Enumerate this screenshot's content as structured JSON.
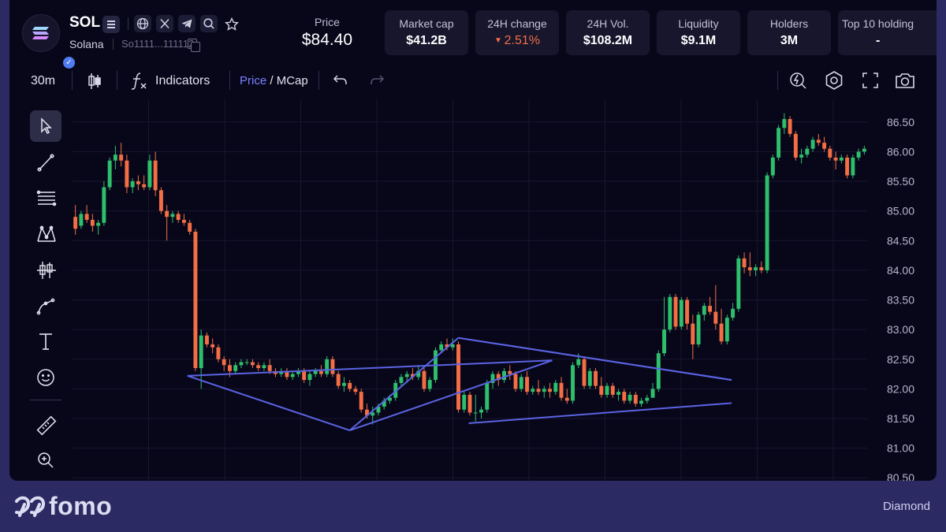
{
  "token": {
    "symbol": "SOL",
    "name": "Solana",
    "address": "So1111...111112"
  },
  "header_icons": [
    "menu-icon",
    "globe-icon",
    "x-icon",
    "telegram-icon",
    "search-icon",
    "star-icon"
  ],
  "price": {
    "label": "Price",
    "value": "$84.40"
  },
  "stats": [
    {
      "label": "Market cap",
      "value": "$41.2B"
    },
    {
      "label": "24H change",
      "value": "2.51%",
      "direction": "down"
    },
    {
      "label": "24H Vol.",
      "value": "$108.2M"
    },
    {
      "label": "Liquidity",
      "value": "$9.1M"
    },
    {
      "label": "Holders",
      "value": "3M"
    },
    {
      "label": "Top 10 holding",
      "value": "-"
    }
  ],
  "toolbar": {
    "interval": "30m",
    "indicators_label": "Indicators",
    "price_label": "Price",
    "mcap_sep": " / ",
    "mcap_label": "MCap"
  },
  "left_tools": [
    "cursor-icon",
    "trendline-icon",
    "fib-icon",
    "pattern-icon",
    "candles-icon",
    "path-icon",
    "text-icon",
    "emoji-icon",
    "ruler-icon",
    "zoom-in-icon"
  ],
  "right_tools": [
    "replay-icon",
    "settings-icon",
    "fullscreen-icon",
    "camera-icon"
  ],
  "colors": {
    "up": "#2dbf6c",
    "down": "#f36e45",
    "pattern": "#5b63e3",
    "accent": "#7c82ff"
  },
  "footer": {
    "brand": "fomo",
    "tier": "Diamond"
  },
  "chart_data": {
    "type": "candlestick",
    "y_ticks": [
      "86.50",
      "86.00",
      "85.50",
      "85.00",
      "84.50",
      "84.00",
      "83.50",
      "83.00",
      "82.50",
      "82.00",
      "81.50",
      "81.00",
      "80.50"
    ],
    "ylim": [
      80.45,
      86.75
    ],
    "grid": true,
    "ohlc": [
      [
        84.9,
        85.1,
        84.6,
        84.7
      ],
      [
        84.75,
        85.0,
        84.7,
        84.95
      ],
      [
        84.95,
        85.1,
        84.8,
        84.85
      ],
      [
        84.85,
        84.95,
        84.65,
        84.75
      ],
      [
        84.75,
        84.85,
        84.6,
        84.8
      ],
      [
        84.8,
        85.5,
        84.75,
        85.4
      ],
      [
        85.4,
        85.9,
        85.35,
        85.85
      ],
      [
        85.85,
        86.1,
        85.7,
        85.95
      ],
      [
        85.95,
        86.15,
        85.75,
        85.85
      ],
      [
        85.85,
        85.95,
        85.3,
        85.4
      ],
      [
        85.4,
        85.55,
        85.3,
        85.5
      ],
      [
        85.5,
        85.6,
        85.35,
        85.45
      ],
      [
        85.45,
        85.6,
        85.35,
        85.4
      ],
      [
        85.4,
        85.95,
        85.35,
        85.85
      ],
      [
        85.85,
        86.0,
        85.25,
        85.35
      ],
      [
        85.35,
        85.4,
        84.95,
        85.0
      ],
      [
        85.0,
        85.1,
        84.5,
        84.9
      ],
      [
        84.9,
        85.0,
        84.8,
        84.95
      ],
      [
        84.95,
        85.0,
        84.8,
        84.85
      ],
      [
        84.85,
        84.95,
        84.75,
        84.8
      ],
      [
        84.8,
        84.85,
        84.6,
        84.65
      ],
      [
        84.65,
        84.7,
        82.3,
        82.35
      ],
      [
        82.35,
        83.0,
        82.0,
        82.9
      ],
      [
        82.9,
        82.95,
        82.7,
        82.75
      ],
      [
        82.75,
        82.85,
        82.6,
        82.7
      ],
      [
        82.7,
        82.75,
        82.45,
        82.5
      ],
      [
        82.5,
        82.55,
        82.3,
        82.4
      ],
      [
        82.4,
        82.5,
        82.2,
        82.3
      ],
      [
        82.3,
        82.45,
        82.25,
        82.4
      ],
      [
        82.4,
        82.5,
        82.35,
        82.45
      ],
      [
        82.45,
        82.5,
        82.4,
        82.45
      ],
      [
        82.45,
        82.5,
        82.35,
        82.4
      ],
      [
        82.4,
        82.45,
        82.3,
        82.35
      ],
      [
        82.35,
        82.45,
        82.3,
        82.4
      ],
      [
        82.4,
        82.5,
        82.25,
        82.3
      ],
      [
        82.3,
        82.35,
        82.2,
        82.25
      ],
      [
        82.25,
        82.35,
        82.2,
        82.3
      ],
      [
        82.3,
        82.35,
        82.15,
        82.2
      ],
      [
        82.2,
        82.3,
        82.15,
        82.25
      ],
      [
        82.25,
        82.35,
        82.2,
        82.3
      ],
      [
        82.3,
        82.35,
        82.1,
        82.15
      ],
      [
        82.15,
        82.3,
        82.05,
        82.25
      ],
      [
        82.25,
        82.35,
        82.2,
        82.3
      ],
      [
        82.3,
        82.4,
        82.2,
        82.25
      ],
      [
        82.25,
        82.55,
        82.2,
        82.5
      ],
      [
        82.5,
        82.55,
        82.2,
        82.25
      ],
      [
        82.25,
        82.3,
        82.0,
        82.05
      ],
      [
        82.05,
        82.2,
        81.95,
        82.1
      ],
      [
        82.1,
        82.15,
        81.95,
        82.0
      ],
      [
        82.0,
        82.05,
        81.9,
        81.95
      ],
      [
        81.95,
        82.0,
        81.6,
        81.65
      ],
      [
        81.65,
        81.75,
        81.5,
        81.55
      ],
      [
        81.55,
        81.7,
        81.4,
        81.6
      ],
      [
        81.6,
        81.75,
        81.55,
        81.7
      ],
      [
        81.7,
        81.85,
        81.65,
        81.8
      ],
      [
        81.8,
        81.9,
        81.75,
        81.85
      ],
      [
        81.85,
        82.15,
        81.8,
        82.1
      ],
      [
        82.1,
        82.25,
        82.05,
        82.2
      ],
      [
        82.2,
        82.3,
        82.1,
        82.25
      ],
      [
        82.25,
        82.35,
        82.15,
        82.2
      ],
      [
        82.2,
        82.4,
        82.15,
        82.3
      ],
      [
        82.3,
        82.35,
        81.95,
        82.0
      ],
      [
        82.0,
        82.2,
        81.95,
        82.15
      ],
      [
        82.15,
        82.7,
        82.1,
        82.65
      ],
      [
        82.65,
        82.8,
        82.6,
        82.75
      ],
      [
        82.75,
        82.85,
        82.65,
        82.7
      ],
      [
        82.7,
        82.85,
        82.65,
        82.75
      ],
      [
        82.75,
        82.8,
        81.6,
        81.65
      ],
      [
        81.65,
        81.95,
        81.6,
        81.9
      ],
      [
        81.9,
        81.95,
        81.55,
        81.6
      ],
      [
        81.6,
        81.9,
        81.45,
        81.6
      ],
      [
        81.6,
        81.7,
        81.5,
        81.65
      ],
      [
        81.65,
        82.15,
        81.6,
        82.1
      ],
      [
        82.1,
        82.3,
        82.0,
        82.25
      ],
      [
        82.25,
        82.3,
        82.05,
        82.15
      ],
      [
        82.15,
        82.35,
        82.1,
        82.3
      ],
      [
        82.3,
        82.4,
        82.15,
        82.25
      ],
      [
        82.25,
        82.3,
        81.95,
        82.0
      ],
      [
        82.0,
        82.25,
        81.95,
        82.2
      ],
      [
        82.2,
        82.3,
        81.9,
        81.95
      ],
      [
        81.95,
        82.05,
        81.9,
        82.0
      ],
      [
        82.0,
        82.15,
        81.9,
        81.95
      ],
      [
        81.95,
        82.05,
        81.85,
        82.0
      ],
      [
        82.0,
        82.1,
        81.85,
        81.95
      ],
      [
        81.95,
        82.15,
        81.9,
        82.1
      ],
      [
        82.1,
        82.2,
        81.8,
        81.85
      ],
      [
        81.85,
        82.0,
        81.75,
        81.8
      ],
      [
        81.8,
        82.45,
        81.75,
        82.4
      ],
      [
        82.4,
        82.6,
        82.35,
        82.5
      ],
      [
        82.5,
        82.55,
        82.0,
        82.05
      ],
      [
        82.05,
        82.35,
        82.0,
        82.3
      ],
      [
        82.3,
        82.35,
        82.0,
        82.05
      ],
      [
        82.05,
        82.2,
        81.85,
        81.9
      ],
      [
        81.9,
        82.1,
        81.85,
        82.05
      ],
      [
        82.05,
        82.1,
        81.85,
        81.9
      ],
      [
        81.9,
        82.0,
        81.8,
        81.95
      ],
      [
        81.95,
        82.0,
        81.75,
        81.8
      ],
      [
        81.8,
        81.95,
        81.75,
        81.9
      ],
      [
        81.9,
        81.95,
        81.7,
        81.75
      ],
      [
        81.75,
        81.85,
        81.7,
        81.8
      ],
      [
        81.8,
        81.9,
        81.75,
        81.85
      ],
      [
        81.85,
        82.1,
        81.85,
        82.0
      ],
      [
        82.0,
        82.65,
        81.95,
        82.6
      ],
      [
        82.6,
        83.55,
        82.55,
        83.0
      ],
      [
        83.0,
        83.6,
        82.95,
        83.55
      ],
      [
        83.55,
        83.6,
        83.0,
        83.05
      ],
      [
        83.05,
        83.55,
        83.0,
        83.5
      ],
      [
        83.5,
        83.55,
        83.0,
        83.1
      ],
      [
        83.1,
        83.25,
        82.5,
        82.75
      ],
      [
        82.75,
        83.3,
        82.7,
        83.25
      ],
      [
        83.25,
        83.45,
        83.15,
        83.4
      ],
      [
        83.4,
        83.55,
        83.25,
        83.3
      ],
      [
        83.3,
        83.75,
        83.0,
        83.1
      ],
      [
        83.1,
        83.35,
        82.75,
        82.8
      ],
      [
        82.8,
        83.25,
        82.75,
        83.2
      ],
      [
        83.2,
        83.45,
        83.15,
        83.35
      ],
      [
        83.35,
        84.25,
        83.3,
        84.2
      ],
      [
        84.2,
        84.3,
        83.95,
        84.05
      ],
      [
        84.05,
        84.3,
        83.9,
        84.0
      ],
      [
        84.0,
        84.1,
        83.9,
        84.05
      ],
      [
        84.05,
        84.15,
        83.95,
        84.0
      ],
      [
        84.0,
        85.65,
        83.95,
        85.6
      ],
      [
        85.6,
        85.95,
        85.55,
        85.9
      ],
      [
        85.9,
        86.45,
        85.85,
        86.4
      ],
      [
        86.4,
        86.65,
        86.3,
        86.55
      ],
      [
        86.55,
        86.6,
        86.25,
        86.3
      ],
      [
        86.3,
        86.35,
        85.85,
        85.9
      ],
      [
        85.9,
        86.05,
        85.8,
        85.95
      ],
      [
        85.95,
        86.1,
        85.9,
        86.05
      ],
      [
        86.05,
        86.25,
        86.0,
        86.2
      ],
      [
        86.2,
        86.3,
        86.1,
        86.15
      ],
      [
        86.15,
        86.25,
        86.0,
        86.05
      ],
      [
        86.05,
        86.1,
        85.85,
        85.9
      ],
      [
        85.9,
        86.0,
        85.7,
        85.85
      ],
      [
        85.85,
        85.95,
        85.8,
        85.9
      ],
      [
        85.9,
        85.95,
        85.55,
        85.6
      ],
      [
        85.6,
        85.95,
        85.55,
        85.9
      ],
      [
        85.9,
        86.05,
        85.85,
        86.0
      ],
      [
        86.0,
        86.1,
        85.95,
        86.05
      ]
    ],
    "pattern_points": [
      [
        83.4,
        82.48
      ],
      [
        19.6,
        82.22
      ],
      [
        48,
        81.3
      ],
      [
        67,
        82.86
      ],
      [
        114.8,
        82.15
      ],
      [
        114.8,
        81.76
      ],
      [
        68.8,
        81.42
      ]
    ],
    "pattern_lines": [
      [
        0,
        2
      ],
      [
        2,
        3
      ],
      [
        3,
        4
      ],
      [
        0,
        1
      ],
      [
        1,
        2
      ],
      [
        5,
        6
      ],
      [
        3,
        4
      ]
    ]
  }
}
